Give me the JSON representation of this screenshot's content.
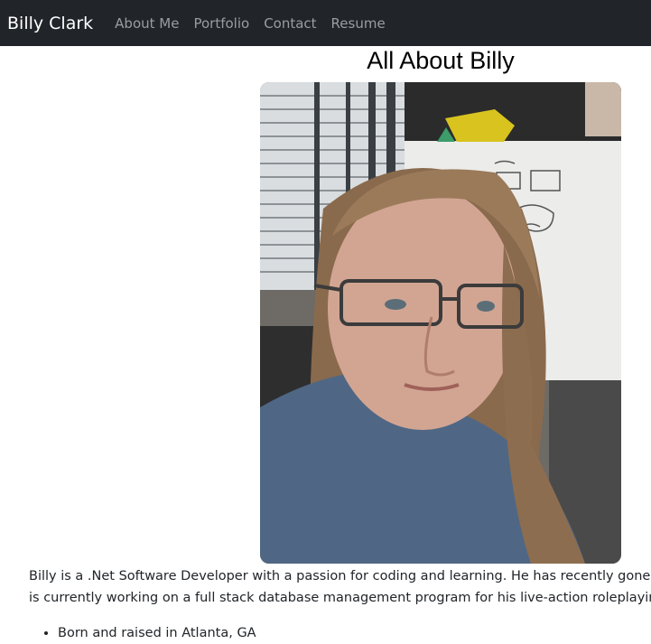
{
  "nav": {
    "brand": "Billy Clark",
    "links": [
      "About Me",
      "Portfolio",
      "Contact",
      "Resume"
    ]
  },
  "main": {
    "title": "All About Billy",
    "photo": {
      "subject": "portrait-photo"
    },
    "bio_lines": [
      "Billy is a .Net Software Developer with a passion for coding and learning. He has recently gone thr",
      "is currently working on a full stack database management program for his live-action roleplaying g"
    ],
    "facts": [
      "Born and raised in Atlanta, GA"
    ]
  },
  "colors": {
    "navbar_bg": "#212529",
    "brand_text": "#ffffff",
    "nav_link_text": "#9a9da0",
    "body_text": "#212529"
  }
}
